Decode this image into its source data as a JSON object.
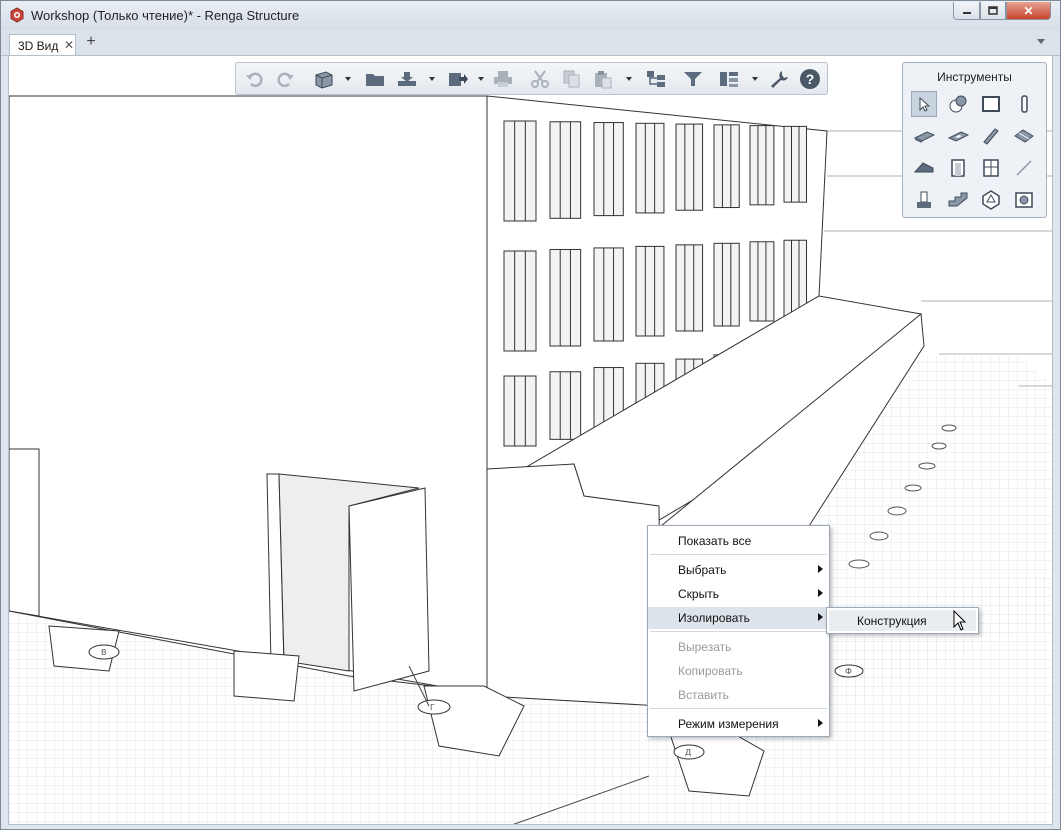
{
  "window": {
    "title": "Workshop (Только чтение)* - Renga Structure",
    "close_glyph": "✕"
  },
  "tabs": [
    {
      "label": "3D Вид",
      "close_glyph": "✕"
    }
  ],
  "tab_add_glyph": "+",
  "toolbar": {
    "buttons": [
      "undo-icon",
      "redo-icon",
      "view-cube-icon",
      "open-folder-icon",
      "import-icon",
      "export-icon",
      "print-icon",
      "cut-icon",
      "copy-icon",
      "paste-icon",
      "hierarchy-icon",
      "filter-icon",
      "layout-icon",
      "settings-wrench-icon",
      "help-icon"
    ],
    "help_glyph": "?"
  },
  "tools_panel": {
    "title": "Инструменты",
    "tools": [
      "select-arrow-icon",
      "level-marker-icon",
      "wall-icon",
      "column-icon",
      "slab-icon",
      "opening-icon",
      "beam-icon",
      "ribbon-icon",
      "roof-icon",
      "door-icon",
      "window-icon",
      "line-icon",
      "element-icon",
      "stair-icon",
      "rebar-icon",
      "isolate-view-icon"
    ]
  },
  "context_menu": {
    "items": [
      {
        "label": "Показать все",
        "enabled": true,
        "submenu": false
      },
      {
        "label": "Выбрать",
        "enabled": true,
        "submenu": true
      },
      {
        "label": "Скрыть",
        "enabled": true,
        "submenu": true
      },
      {
        "label": "Изолировать",
        "enabled": true,
        "submenu": true,
        "highlighted": true
      },
      {
        "label": "Вырезать",
        "enabled": false,
        "submenu": false
      },
      {
        "label": "Копировать",
        "enabled": false,
        "submenu": false
      },
      {
        "label": "Вставить",
        "enabled": false,
        "submenu": false
      },
      {
        "label": "Режим измерения",
        "enabled": true,
        "submenu": true
      }
    ],
    "submenu": {
      "items": [
        {
          "label": "Конструкция"
        }
      ]
    }
  },
  "scene": {
    "axis_labels": [
      "В",
      "Г",
      "Д",
      "Ф"
    ],
    "colors": {
      "background": "#ffffff",
      "lines": "#333333",
      "grid": "#d5d8dc",
      "title_bar": "#d7dee7",
      "close_button": "#c8442d",
      "menu_highlight": "#dde3ea"
    }
  }
}
